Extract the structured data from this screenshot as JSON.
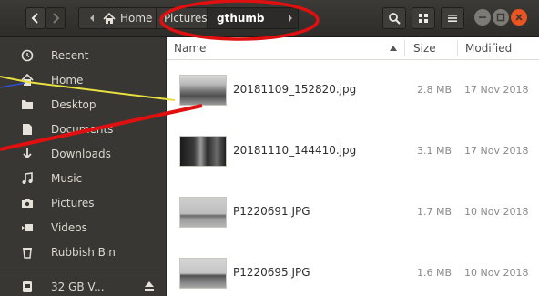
{
  "header": {
    "breadcrumbs": [
      {
        "label": "Home",
        "icon": "home-icon"
      },
      {
        "label": "Pictures"
      },
      {
        "label": "gthumb"
      }
    ],
    "buttons": [
      "back-icon",
      "forward-icon",
      "search-icon",
      "view-options-icon",
      "menu-icon"
    ],
    "window_controls": [
      "minimize",
      "maximize",
      "close"
    ]
  },
  "sidebar": {
    "items": [
      {
        "label": "Recent",
        "icon": "clock-icon"
      },
      {
        "label": "Home",
        "icon": "home-icon"
      },
      {
        "label": "Desktop",
        "icon": "folder-icon"
      },
      {
        "label": "Documents",
        "icon": "document-icon"
      },
      {
        "label": "Downloads",
        "icon": "download-icon"
      },
      {
        "label": "Music",
        "icon": "music-icon"
      },
      {
        "label": "Pictures",
        "icon": "camera-icon"
      },
      {
        "label": "Videos",
        "icon": "video-icon"
      },
      {
        "label": "Rubbish Bin",
        "icon": "trash-icon"
      },
      {
        "label": "32 GB V...",
        "icon": "drive-icon"
      }
    ]
  },
  "columns": {
    "name": "Name",
    "size": "Size",
    "modified": "Modified"
  },
  "files": [
    {
      "name": "20181109_152820.jpg",
      "size": "2.8 MB",
      "modified": "17 Nov 2018"
    },
    {
      "name": "20181110_144410.jpg",
      "size": "3.1 MB",
      "modified": "17 Nov 2018"
    },
    {
      "name": "P1220691.JPG",
      "size": "1.7 MB",
      "modified": "10 Nov 2018"
    },
    {
      "name": "P1220695.JPG",
      "size": "1.6 MB",
      "modified": "10 Nov 2018"
    }
  ],
  "colors": {
    "headerbar": "#2e2d2a",
    "sidebar": "#383733",
    "annotation_red": "#e01010",
    "annotation_yellow": "#e8e040",
    "annotation_blue": "#3050d0",
    "close_button": "#e95420"
  }
}
